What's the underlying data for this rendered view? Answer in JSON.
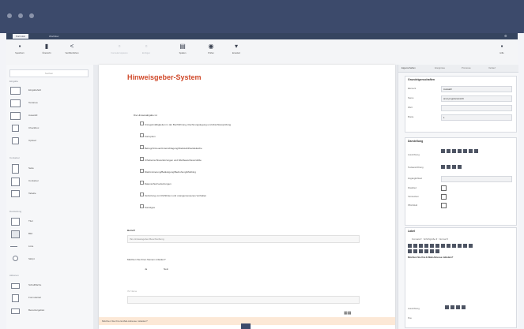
{
  "window": {
    "tabs": [
      "Formular",
      "Workflow"
    ]
  },
  "toolbar": {
    "buttons": [
      {
        "icon": "save-icon",
        "label": "Speichern"
      },
      {
        "icon": "document-icon",
        "label": "Übersicht"
      },
      {
        "icon": "share-icon",
        "label": "Veröffentlichen"
      },
      {
        "icon": "copy-icon",
        "label": "Formular kopieren"
      },
      {
        "icon": "paste-icon",
        "label": "Einfügen"
      },
      {
        "icon": "grid-icon",
        "label": "Spalten"
      },
      {
        "icon": "target-icon",
        "label": "Prüfen"
      },
      {
        "icon": "more-icon",
        "label": "Erweitert"
      },
      {
        "icon": "chevron-icon",
        "label": "Hilfe"
      }
    ]
  },
  "left_panel": {
    "search_placeholder": "Suchen",
    "sections": [
      {
        "title": "Eingabe",
        "items": [
          "Eingabefeld",
          "Textarea",
          "Auswahl",
          "Checkbox",
          "Upload"
        ]
      },
      {
        "title": "Container",
        "items": [
          "Seite",
          "Container",
          "Tabelle"
        ]
      },
      {
        "title": "Darstellung",
        "items": [
          "Titel",
          "Bild",
          "Linie",
          "Skript"
        ]
      },
      {
        "title": "Aktionen",
        "items": [
          "Schaltfläche",
          "Formularteil",
          "Benutzergebiet"
        ]
      }
    ]
  },
  "document": {
    "title": "Hinweisgeber-System",
    "question1": "Die Hinweisabgabe ist",
    "options": [
      "Unregelmäßigkeiten in der Buchführung, Rechnungslegung und Abschlussprüfung",
      "Korruption",
      "Betrug/Untreue/Unterschlagung/Diebstahl/Geldwäsche",
      "Urheberrechtsverletzungen und Wettbewerbsverstöße",
      "Diskriminierung/Belästigung/Bedrohung/Mobbing",
      "Datenschutzverletzungen",
      "Verletzung von Richtlinien und unangemessenes Verhalten",
      "Sonstiges"
    ],
    "betreff_label": "Betreff",
    "betreff_value": "Ihre Hinweisgeber-Beschreibung",
    "anon_question": "Möchten Sie Ihren Namen mitteilen?",
    "anon_options": [
      "Ja",
      "Nein"
    ],
    "name_label": "Ihr Name",
    "name_placeholder": "",
    "email_question": "Möchten Sie Ihre E-Mail-Adresse mitteilen?"
  },
  "right_panel": {
    "tabs": [
      "Eigenschaften",
      "Ereignisse",
      "Prozesse",
      "Verlauf"
    ],
    "grund": {
      "title": "Grundeigenschaften",
      "rows": [
        {
          "k": "Element",
          "v": "Auswahl"
        },
        {
          "k": "Name",
          "v": "anonymgeberansicht"
        },
        {
          "k": "Wert",
          "v": ""
        },
        {
          "k": "Breite",
          "v": "1"
        }
      ]
    },
    "darstellung": {
      "title": "Darstellung",
      "rows": [
        "Ausrichtung",
        "Textausrichtung",
        "Zugänglichkeit",
        "Disabled",
        "Verstecken",
        "Pflichtfeld"
      ]
    },
    "label": {
      "title": "Label",
      "format": "Formats",
      "size": "Schriftgröße",
      "weight": "Normal",
      "text": "Möchten Sie Ihre E-Mail-Adresse mitteilen?",
      "align_label": "Ausrichtung",
      "pos_label": "Pos"
    }
  },
  "colors": {
    "accent": "#d0492a",
    "frame": "#3c4a6b"
  }
}
